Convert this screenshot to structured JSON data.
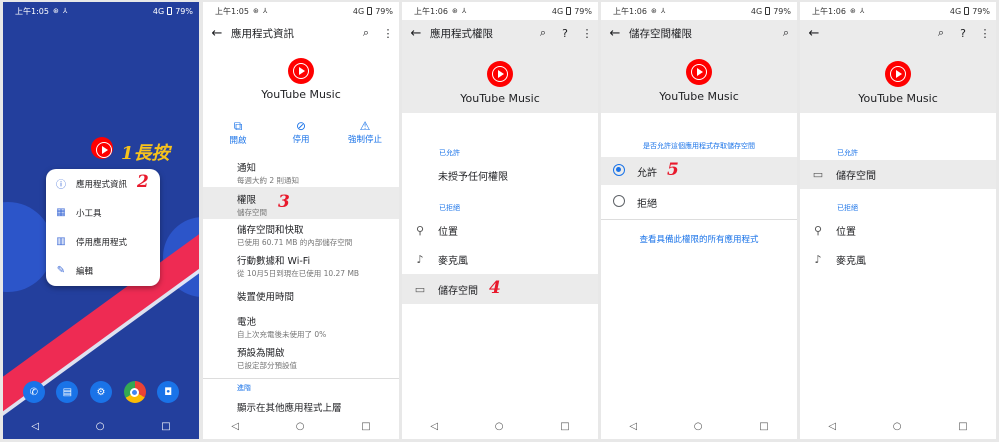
{
  "status": {
    "time1": "上午1:05",
    "time2": "上午1:05",
    "time3": "上午1:06",
    "time4": "上午1:06",
    "time5": "上午1:06",
    "icons": "⊛ ⅄",
    "signal": "4G",
    "battery": "79%"
  },
  "panel1": {
    "step1_num": "1",
    "step1_label": "長按",
    "step2_num": "2",
    "menu": [
      "應用程式資訊",
      "小工具",
      "停用應用程式",
      "編輯"
    ]
  },
  "panel2": {
    "title": "應用程式資訊",
    "app_name": "YouTube Music",
    "actions": [
      "開啟",
      "停用",
      "強制停止"
    ],
    "items": [
      {
        "title": "通知",
        "sub": "每週大約 2 則通知"
      },
      {
        "title": "權限",
        "sub": "儲存空間"
      },
      {
        "title": "儲存空間和快取",
        "sub": "已使用 60.71 MB 的內部儲存空間"
      },
      {
        "title": "行動數據和 Wi-Fi",
        "sub": "從 10月5日到現在已使用 10.27 MB"
      },
      {
        "title": "裝置使用時間",
        "sub": ""
      },
      {
        "title": "電池",
        "sub": "自上次充電後未使用了 0%"
      },
      {
        "title": "預設為開啟",
        "sub": "已設定部分預設值"
      }
    ],
    "advanced_label": "進階",
    "advanced_item": "顯示在其他應用程式上層",
    "step3_num": "3"
  },
  "panel3": {
    "title": "應用程式權限",
    "app_name": "YouTube Music",
    "allowed_header": "已允許",
    "allowed_none": "未授予任何權限",
    "denied_header": "已拒絕",
    "denied": [
      "位置",
      "麥克風",
      "儲存空間"
    ],
    "step4_num": "4"
  },
  "panel4": {
    "title": "儲存空間權限",
    "app_name": "YouTube Music",
    "question": "是否允許這個應用程式存取儲存空間",
    "options": [
      "允許",
      "拒絕"
    ],
    "selected": "允許",
    "link": "查看具備此權限的所有應用程式",
    "step5_num": "5"
  },
  "panel5": {
    "app_name": "YouTube Music",
    "allowed_header": "已允許",
    "allowed": [
      "儲存空間"
    ],
    "denied_header": "已拒絕",
    "denied": [
      "位置",
      "麥克風"
    ]
  },
  "nav": {
    "back": "◁",
    "home": "○",
    "recent": "□"
  },
  "icons": {
    "back_arrow": "arrow-left-icon",
    "search": "search-icon",
    "help": "help-icon",
    "more": "more-vert-icon"
  },
  "colors": {
    "accent": "#1a73e8",
    "step_number": "#e8192c",
    "longpress": "#f6c21c",
    "wallpaper": "#233f9d",
    "highlight": "#ebebeb"
  }
}
